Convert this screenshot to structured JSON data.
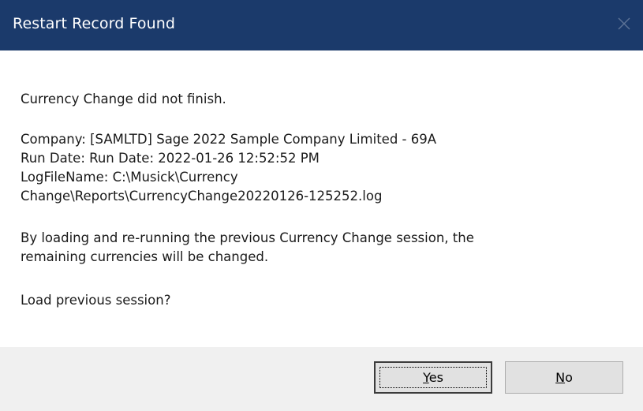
{
  "dialog": {
    "title": "Restart Record Found",
    "close_icon": "close-icon",
    "colors": {
      "titlebar": "#1b3a6b",
      "title_text": "#ffffff",
      "body_bg": "#ffffff",
      "footer_bg": "#f0f0f0"
    }
  },
  "message": {
    "status": "Currency Change did not finish.",
    "company": "Company:  [SAMLTD] Sage 2022 Sample Company Limited  - 69A",
    "run_date": "Run Date: Run Date: 2022-01-26  12:52:52 PM",
    "log_line1": "LogFileName: C:\\Musick\\Currency",
    "log_line2": "Change\\Reports\\CurrencyChange20220126-125252.log",
    "explain_line1": "By loading and re-running the previous Currency  Change session, the",
    "explain_line2": "remaining currencies  will be changed.",
    "prompt": "Load previous session?"
  },
  "buttons": {
    "yes": {
      "accel": "Y",
      "rest": "es"
    },
    "no": {
      "accel": "N",
      "rest": "o"
    }
  }
}
